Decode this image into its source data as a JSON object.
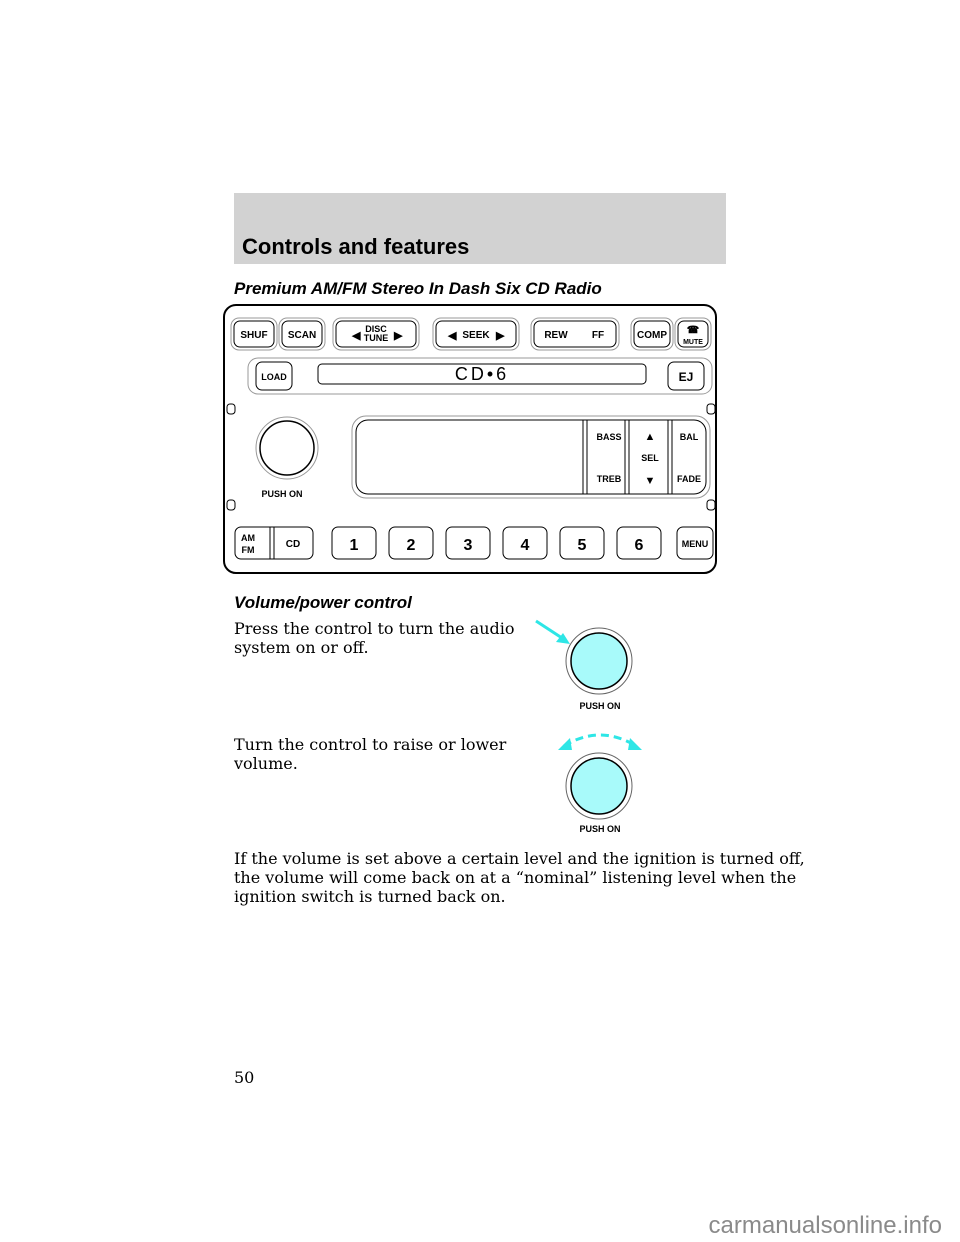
{
  "header": {
    "title": "Controls and features"
  },
  "section_title": "Premium AM/FM Stereo In Dash Six CD Radio",
  "radio": {
    "top_buttons": [
      "SHUF",
      "SCAN",
      "DISC TUNE",
      "SEEK",
      "REW",
      "FF",
      "COMP",
      "MUTE"
    ],
    "disc_line1": "DISC",
    "disc_line2": "TUNE",
    "load": "LOAD",
    "slot_label": "CD•6",
    "eject": "EJ",
    "push_on": "PUSH ON",
    "bass": "BASS",
    "treb": "TREB",
    "sel": "SEL",
    "bal": "BAL",
    "fade": "FADE",
    "am": "AM",
    "fm": "FM",
    "cd": "CD",
    "presets": [
      "1",
      "2",
      "3",
      "4",
      "5",
      "6"
    ],
    "menu": "MENU"
  },
  "subsection_title": "Volume/power control",
  "paragraphs": {
    "press": [
      "Press the control to turn the audio",
      "system on or off."
    ],
    "turn": [
      "Turn the control to raise or lower",
      "volume."
    ],
    "note": [
      "If the volume is set above a certain level and the ignition is turned off,",
      "the volume will come back on at a “nominal” listening level when the",
      "ignition switch is turned back on."
    ]
  },
  "figure_labels": {
    "push_on_1": "PUSH ON",
    "push_on_2": "PUSH ON"
  },
  "colors": {
    "accent": "#2ee6e6",
    "knob_fill": "#a8fafa",
    "header_bg": "#d2d2d2"
  },
  "page_number": "50",
  "watermark": "carmanualsonline.info"
}
